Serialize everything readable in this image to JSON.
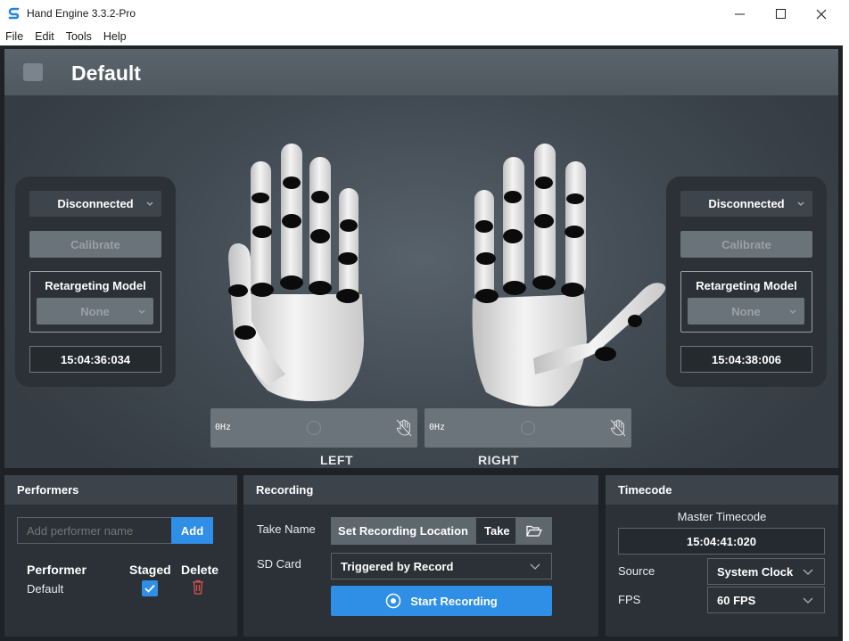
{
  "window": {
    "title": "Hand Engine 3.3.2-Pro"
  },
  "menu": [
    "File",
    "Edit",
    "Tools",
    "Help"
  ],
  "viewport": {
    "profile_name": "Default"
  },
  "left_hand": {
    "connection": "Disconnected",
    "calibrate": "Calibrate",
    "retargeting_label": "Retargeting Model",
    "retargeting_value": "None",
    "time": "15:04:36:034",
    "hz": "0Hz",
    "label": "LEFT"
  },
  "right_hand": {
    "connection": "Disconnected",
    "calibrate": "Calibrate",
    "retargeting_label": "Retargeting Model",
    "retargeting_value": "None",
    "time": "15:04:38:006",
    "hz": "0Hz",
    "label": "RIGHT"
  },
  "performers": {
    "title": "Performers",
    "input_placeholder": "Add performer name",
    "add_label": "Add",
    "col_performer": "Performer",
    "col_staged": "Staged",
    "col_delete": "Delete",
    "rows": [
      {
        "name": "Default",
        "staged": true
      }
    ]
  },
  "recording": {
    "title": "Recording",
    "take_name_label": "Take Name",
    "set_location_label": "Set Recording Location",
    "take_value": "Take",
    "sd_card_label": "SD Card",
    "sd_card_value": "Triggered by Record",
    "start_label": "Start Recording"
  },
  "timecode": {
    "title": "Timecode",
    "master_label": "Master Timecode",
    "master_value": "15:04:41:020",
    "source_label": "Source",
    "source_value": "System Clock",
    "fps_label": "FPS",
    "fps_value": "60 FPS"
  },
  "colors": {
    "accent": "#2f8ee6",
    "delete": "#d9534f",
    "panel": "#2b3136"
  }
}
